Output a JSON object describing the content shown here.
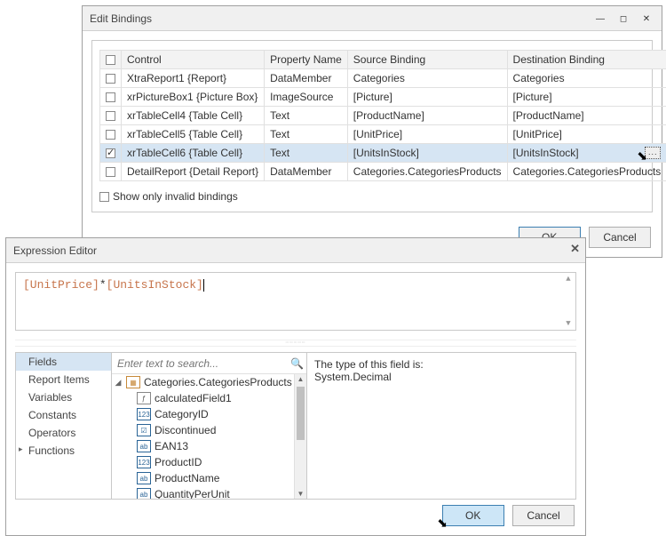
{
  "edit_bindings": {
    "title": "Edit Bindings",
    "columns": {
      "control": "Control",
      "property": "Property Name",
      "source": "Source Binding",
      "destination": "Destination Binding"
    },
    "rows": [
      {
        "checked": false,
        "control": "XtraReport1 {Report}",
        "property": "DataMember",
        "source": "Categories",
        "destination": "Categories"
      },
      {
        "checked": false,
        "control": "xrPictureBox1 {Picture Box}",
        "property": "ImageSource",
        "source": "[Picture]",
        "destination": "[Picture]"
      },
      {
        "checked": false,
        "control": "xrTableCell4 {Table Cell}",
        "property": "Text",
        "source": "[ProductName]",
        "destination": "[ProductName]"
      },
      {
        "checked": false,
        "control": "xrTableCell5 {Table Cell}",
        "property": "Text",
        "source": "[UnitPrice]",
        "destination": "[UnitPrice]"
      },
      {
        "checked": true,
        "control": "xrTableCell6 {Table Cell}",
        "property": "Text",
        "source": "[UnitsInStock]",
        "destination": "[UnitsInStock]"
      },
      {
        "checked": false,
        "control": "DetailReport {Detail Report}",
        "property": "DataMember",
        "source": "Categories.CategoriesProducts",
        "destination": "Categories.CategoriesProducts"
      }
    ],
    "show_invalid_label": "Show only invalid bindings",
    "ok_label": "OK",
    "cancel_label": "Cancel",
    "ellipsis": "..."
  },
  "expression_editor": {
    "title": "Expression Editor",
    "expression_parts": {
      "f1": "[UnitPrice]",
      "op": "*",
      "f2": "[UnitsInStock]"
    },
    "search_placeholder": "Enter text to search...",
    "categories": [
      {
        "label": "Fields",
        "selected": true,
        "children": false
      },
      {
        "label": "Report Items",
        "selected": false,
        "children": false
      },
      {
        "label": "Variables",
        "selected": false,
        "children": false
      },
      {
        "label": "Constants",
        "selected": false,
        "children": false
      },
      {
        "label": "Operators",
        "selected": false,
        "children": false
      },
      {
        "label": "Functions",
        "selected": false,
        "children": true
      }
    ],
    "tree_root": "Categories.CategoriesProducts",
    "tree_items": [
      {
        "icon": "f",
        "label": "calculatedField1"
      },
      {
        "icon": "num",
        "label": "CategoryID"
      },
      {
        "icon": "bool",
        "label": "Discontinued"
      },
      {
        "icon": "str",
        "label": "EAN13"
      },
      {
        "icon": "num",
        "label": "ProductID"
      },
      {
        "icon": "str",
        "label": "ProductName"
      },
      {
        "icon": "str",
        "label": "QuantityPerUnit"
      }
    ],
    "description_l1": "The type of this field is:",
    "description_l2": "System.Decimal",
    "ok_label": "OK",
    "cancel_label": "Cancel"
  }
}
